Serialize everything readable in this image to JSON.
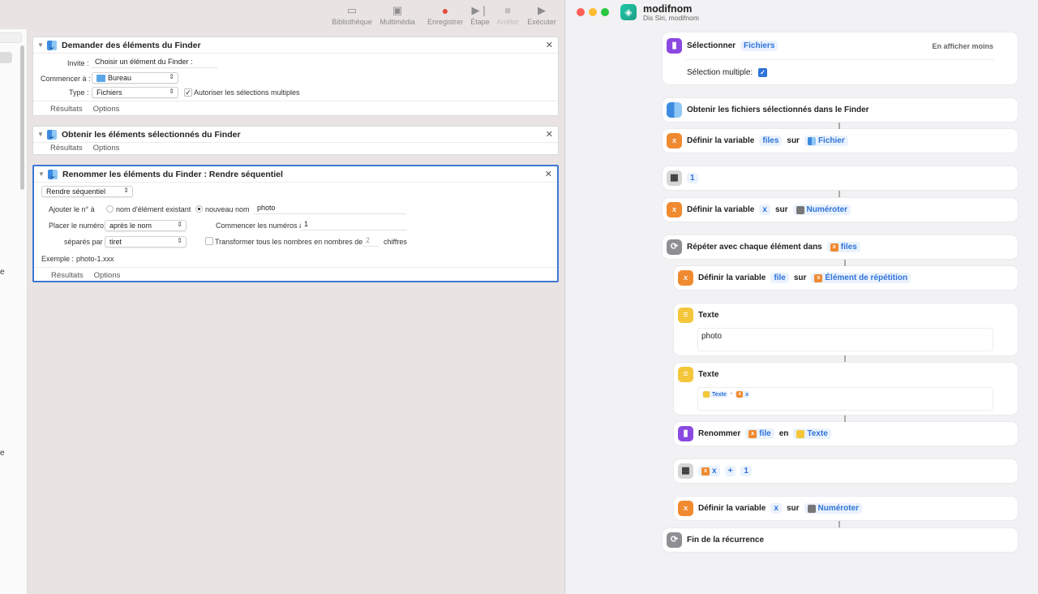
{
  "automator": {
    "toolbar": [
      {
        "label": "Bibliothèque",
        "icon": "sidebar-icon",
        "enabled": true
      },
      {
        "label": "Multimédia",
        "icon": "media-icon",
        "enabled": true
      },
      {
        "label": "Enregistrer",
        "icon": "record-icon",
        "enabled": true
      },
      {
        "label": "Étape",
        "icon": "step-icon",
        "enabled": true
      },
      {
        "label": "Arrêter",
        "icon": "stop-icon",
        "enabled": false
      },
      {
        "label": "Exécuter",
        "icon": "play-icon",
        "enabled": true
      }
    ],
    "library_fragments": [
      "e",
      "e"
    ],
    "card1": {
      "title": "Demander des éléments du Finder",
      "invite_label": "Invite :",
      "invite_value": "Choisir un élément du Finder :",
      "start_label": "Commencer à :",
      "start_value": "Bureau",
      "type_label": "Type :",
      "type_value": "Fichiers",
      "multi_label": "Autoriser les sélections multiples",
      "multi_checked": true,
      "results": "Résultats",
      "options": "Options"
    },
    "card2": {
      "title": "Obtenir les éléments sélectionnés du Finder",
      "results": "Résultats",
      "options": "Options"
    },
    "card3": {
      "title": "Renommer les éléments du Finder : Rendre séquentiel",
      "mode_value": "Rendre séquentiel",
      "add_label": "Ajouter le n° à",
      "radio_existing": "nom d'élément existant",
      "radio_new": "nouveau nom",
      "new_name_value": "photo",
      "place_label": "Placer le numéro",
      "place_value": "après le nom",
      "start_num_label": "Commencer les numéros à",
      "start_num_value": "1",
      "sep_label": "séparés par",
      "sep_value": "tiret",
      "transform_label": "Transformer tous les nombres en nombres de",
      "digits_value": "2",
      "digits_suffix": "chiffres",
      "example_label": "Exemple :",
      "example_value": "photo-1.xxx",
      "results": "Résultats",
      "options": "Options"
    }
  },
  "shortcuts": {
    "title": "modifnom",
    "subtitle": "Dis Siri, modifnom",
    "colors": {
      "close": "#ff5f57",
      "minimize": "#febc2e",
      "zoom": "#28c840",
      "accent": "#2e73d8"
    },
    "select_action": {
      "label": "Sélectionner",
      "token": "Fichiers",
      "toggle": "En afficher moins",
      "multi_label": "Sélection multiple:",
      "multi_checked": true
    },
    "get_finder": {
      "label": "Obtenir les fichiers sélectionnés dans le Finder"
    },
    "setvar1": {
      "label": "Définir la variable",
      "var": "files",
      "on": "sur",
      "value": "Fichier"
    },
    "number1": {
      "value": "1"
    },
    "setvar2": {
      "label": "Définir la variable",
      "var": "x",
      "on": "sur",
      "value": "Numéroter"
    },
    "repeat": {
      "label": "Répéter avec chaque élément dans",
      "var": "files"
    },
    "setvar3": {
      "label": "Définir la variable",
      "var": "file",
      "on": "sur",
      "value": "Élément de répétition"
    },
    "text1": {
      "label": "Texte",
      "content": "photo"
    },
    "text2": {
      "label": "Texte",
      "tok1": "Texte",
      "sep": "-",
      "tok2": "x"
    },
    "rename": {
      "label": "Renommer",
      "var": "file",
      "mid": "en",
      "value": "Texte"
    },
    "calc": {
      "var": "x",
      "op": "+",
      "value": "1"
    },
    "setvar4": {
      "label": "Définir la variable",
      "var": "x",
      "on": "sur",
      "value": "Numéroter"
    },
    "end_repeat": {
      "label": "Fin de la récurrence"
    }
  }
}
